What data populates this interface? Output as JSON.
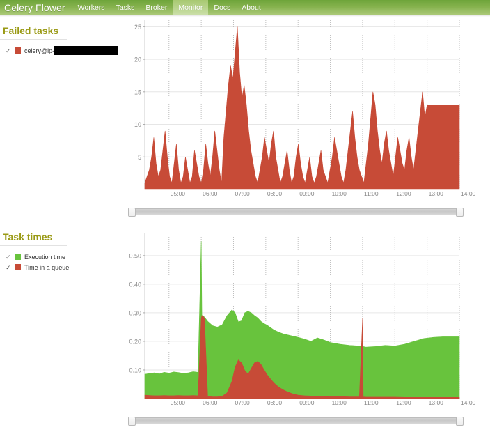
{
  "app": {
    "brand": "Celery Flower"
  },
  "nav": {
    "items": [
      {
        "label": "Workers",
        "active": false
      },
      {
        "label": "Tasks",
        "active": false
      },
      {
        "label": "Broker",
        "active": false
      },
      {
        "label": "Monitor",
        "active": true
      },
      {
        "label": "Docs",
        "active": false
      },
      {
        "label": "About",
        "active": false
      }
    ]
  },
  "colors": {
    "red": "#c74b37",
    "green": "#68c33d",
    "heading": "#9a9a15",
    "nav_top": "#6ea43a",
    "nav_bottom": "#aecb7c",
    "grid": "#e6e6e6",
    "axis_text": "#888888"
  },
  "panels": [
    {
      "title": "Failed tasks",
      "legend": [
        {
          "check": "✓",
          "color": "#c74b37",
          "label": "celery@ip-",
          "redacted": true
        }
      ],
      "slider": {
        "left_handle": " ",
        "right_handle": " "
      }
    },
    {
      "title": "Task times",
      "legend": [
        {
          "check": "✓",
          "color": "#68c33d",
          "label": "Execution time",
          "redacted": false
        },
        {
          "check": "✓",
          "color": "#c74b37",
          "label": "Time in a queue",
          "redacted": false
        }
      ],
      "slider": {
        "left_handle": " ",
        "right_handle": " "
      }
    }
  ],
  "chart_data": [
    {
      "type": "area",
      "title": "Failed tasks",
      "xlabel": "",
      "ylabel": "",
      "grid": true,
      "legend_position": "left-sidebar",
      "xlim": [
        4.25,
        14.0
      ],
      "ylim": [
        0,
        26
      ],
      "yticks": [
        5,
        10,
        15,
        20,
        25
      ],
      "ytick_labels": [
        "5",
        "10",
        "15",
        "20",
        "25"
      ],
      "xticks": [
        5,
        6,
        7,
        8,
        9,
        10,
        11,
        12,
        13,
        14
      ],
      "xtick_labels": [
        "05:00",
        "06:00",
        "07:00",
        "08:00",
        "09:00",
        "10:00",
        "11:00",
        "12:00",
        "13:00",
        "14:00"
      ],
      "series": [
        {
          "name": "celery@ip-",
          "color": "#c74b37",
          "x": [
            4.25,
            4.32,
            4.39,
            4.46,
            4.53,
            4.6,
            4.67,
            4.74,
            4.81,
            4.88,
            4.95,
            5.02,
            5.09,
            5.16,
            5.23,
            5.3,
            5.37,
            5.44,
            5.51,
            5.58,
            5.65,
            5.72,
            5.79,
            5.86,
            5.93,
            6.0,
            6.07,
            6.14,
            6.21,
            6.28,
            6.35,
            6.42,
            6.49,
            6.56,
            6.63,
            6.7,
            6.77,
            6.84,
            6.91,
            6.98,
            7.05,
            7.12,
            7.19,
            7.26,
            7.33,
            7.4,
            7.47,
            7.54,
            7.61,
            7.68,
            7.75,
            7.82,
            7.89,
            7.96,
            8.03,
            8.1,
            8.17,
            8.24,
            8.31,
            8.38,
            8.45,
            8.52,
            8.59,
            8.66,
            8.73,
            8.8,
            8.87,
            8.94,
            9.01,
            9.08,
            9.15,
            9.22,
            9.29,
            9.36,
            9.43,
            9.5,
            9.57,
            9.64,
            9.71,
            9.78,
            9.85,
            9.92,
            9.99,
            10.06,
            10.13,
            10.2,
            10.27,
            10.34,
            10.41,
            10.48,
            10.55,
            10.62,
            10.69,
            10.76,
            10.83,
            10.9,
            10.97,
            11.04,
            11.11,
            11.18,
            11.25,
            11.32,
            11.39,
            11.46,
            11.53,
            11.6,
            11.67,
            11.74,
            11.81,
            11.88,
            11.95,
            12.02,
            12.09,
            12.16,
            12.23,
            12.3,
            12.37,
            12.44,
            12.51,
            12.58,
            12.65,
            12.72,
            12.79,
            12.86,
            12.93,
            13.0,
            13.07,
            13.14,
            13.21,
            13.28,
            13.35,
            13.42,
            14.0
          ],
          "values": [
            1,
            2,
            3,
            5,
            8,
            4,
            2,
            3,
            6,
            9,
            5,
            2,
            1,
            4,
            7,
            3,
            1,
            2,
            5,
            3,
            1,
            2,
            6,
            4,
            2,
            1,
            3,
            7,
            4,
            2,
            5,
            9,
            6,
            3,
            1,
            8,
            12,
            16,
            19,
            17,
            21,
            25,
            18,
            14,
            16,
            13,
            9,
            6,
            4,
            2,
            1,
            3,
            5,
            8,
            6,
            4,
            7,
            9,
            5,
            3,
            1,
            2,
            4,
            6,
            3,
            1,
            2,
            5,
            7,
            4,
            2,
            1,
            3,
            5,
            2,
            1,
            2,
            4,
            6,
            3,
            2,
            1,
            3,
            5,
            8,
            6,
            4,
            2,
            1,
            3,
            6,
            9,
            12,
            8,
            5,
            3,
            2,
            1,
            4,
            7,
            11,
            15,
            13,
            9,
            6,
            4,
            7,
            9,
            6,
            4,
            2,
            5,
            8,
            6,
            4,
            3,
            6,
            8,
            5,
            3,
            6,
            9,
            12,
            15,
            11,
            13,
            13,
            13,
            13,
            13,
            13,
            13,
            13,
            13
          ]
        }
      ]
    },
    {
      "type": "area",
      "title": "Task times",
      "xlabel": "",
      "ylabel": "",
      "grid": true,
      "stacked": true,
      "legend_position": "left-sidebar",
      "xlim": [
        4.25,
        14.0
      ],
      "ylim": [
        0,
        0.58
      ],
      "yticks": [
        0.1,
        0.2,
        0.3,
        0.4,
        0.5
      ],
      "ytick_labels": [
        "0.10",
        "0.20",
        "0.30",
        "0.40",
        "0.50"
      ],
      "xticks": [
        5,
        6,
        7,
        8,
        9,
        10,
        11,
        12,
        13,
        14
      ],
      "xtick_labels": [
        "05:00",
        "06:00",
        "07:00",
        "08:00",
        "09:00",
        "10:00",
        "11:00",
        "12:00",
        "13:00",
        "14:00"
      ],
      "series": [
        {
          "name": "Time in a queue",
          "color": "#c74b37",
          "x": [
            4.25,
            4.4,
            4.55,
            4.7,
            4.85,
            5.0,
            5.15,
            5.3,
            5.45,
            5.6,
            5.75,
            5.9,
            6.0,
            6.02,
            6.05,
            6.1,
            6.2,
            6.35,
            6.5,
            6.65,
            6.8,
            6.95,
            7.05,
            7.15,
            7.25,
            7.35,
            7.45,
            7.55,
            7.65,
            7.75,
            7.85,
            7.95,
            8.05,
            8.15,
            8.25,
            8.4,
            8.55,
            8.7,
            8.85,
            9.0,
            9.2,
            9.4,
            9.6,
            9.8,
            10.0,
            10.3,
            10.6,
            10.9,
            11.0,
            11.02,
            11.1,
            11.4,
            11.7,
            12.0,
            12.3,
            12.6,
            12.9,
            13.2,
            13.5,
            14.0
          ],
          "values": [
            0.012,
            0.011,
            0.01,
            0.01,
            0.011,
            0.01,
            0.01,
            0.011,
            0.01,
            0.01,
            0.011,
            0.01,
            0.28,
            0.29,
            0.29,
            0.28,
            0.008,
            0.006,
            0.006,
            0.008,
            0.02,
            0.06,
            0.11,
            0.135,
            0.125,
            0.098,
            0.085,
            0.105,
            0.125,
            0.13,
            0.12,
            0.1,
            0.082,
            0.068,
            0.055,
            0.04,
            0.03,
            0.022,
            0.016,
            0.012,
            0.01,
            0.009,
            0.008,
            0.008,
            0.007,
            0.007,
            0.006,
            0.006,
            0.28,
            0.006,
            0.005,
            0.005,
            0.005,
            0.005,
            0.004,
            0.004,
            0.004,
            0.004,
            0.004,
            0.004
          ]
        },
        {
          "name": "Execution time",
          "color": "#68c33d",
          "x": [
            4.25,
            4.4,
            4.55,
            4.7,
            4.85,
            5.0,
            5.15,
            5.3,
            5.45,
            5.6,
            5.75,
            5.9,
            6.0,
            6.02,
            6.05,
            6.1,
            6.2,
            6.35,
            6.5,
            6.65,
            6.8,
            6.95,
            7.05,
            7.15,
            7.25,
            7.35,
            7.45,
            7.55,
            7.65,
            7.75,
            7.85,
            7.95,
            8.05,
            8.15,
            8.25,
            8.4,
            8.55,
            8.7,
            8.85,
            9.0,
            9.2,
            9.4,
            9.6,
            9.8,
            10.0,
            10.3,
            10.6,
            10.9,
            11.0,
            11.02,
            11.1,
            11.4,
            11.7,
            12.0,
            12.3,
            12.6,
            12.9,
            13.2,
            13.5,
            14.0
          ],
          "values": [
            0.085,
            0.088,
            0.09,
            0.086,
            0.092,
            0.089,
            0.093,
            0.091,
            0.088,
            0.09,
            0.094,
            0.092,
            0.55,
            0.29,
            0.29,
            0.285,
            0.27,
            0.255,
            0.25,
            0.258,
            0.29,
            0.31,
            0.3,
            0.268,
            0.272,
            0.3,
            0.305,
            0.3,
            0.29,
            0.282,
            0.27,
            0.262,
            0.256,
            0.248,
            0.24,
            0.232,
            0.226,
            0.222,
            0.218,
            0.214,
            0.208,
            0.2,
            0.212,
            0.205,
            0.196,
            0.19,
            0.186,
            0.184,
            0.182,
            0.182,
            0.18,
            0.182,
            0.186,
            0.184,
            0.19,
            0.2,
            0.21,
            0.214,
            0.216,
            0.216
          ]
        }
      ]
    }
  ]
}
